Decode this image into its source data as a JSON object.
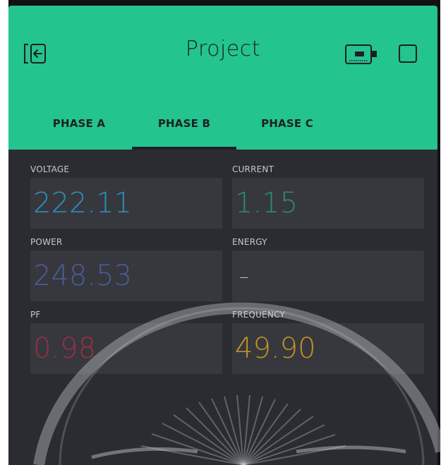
{
  "header": {
    "title": "Project",
    "back_icon": "exit-icon",
    "device_icon": "device-icon",
    "square_icon": "checkbox-icon",
    "background": "#23c48e"
  },
  "tabs": [
    {
      "label": "PHASE A",
      "selected": false
    },
    {
      "label": "PHASE B",
      "selected": true
    },
    {
      "label": "PHASE C",
      "selected": false
    }
  ],
  "widgets": {
    "voltage": {
      "label": "VOLTAGE",
      "value": "222.11",
      "color": "#2f8fb8"
    },
    "current": {
      "label": "CURRENT",
      "value": "1.15",
      "color": "#2e8a6e"
    },
    "power": {
      "label": "POWER",
      "value": "248.53",
      "color": "#4a5e95"
    },
    "energy": {
      "label": "ENERGY",
      "value": "–",
      "color": "#b9bbbf"
    },
    "pf": {
      "label": "PF",
      "value": "0.98",
      "color": "#9a3042"
    },
    "frequency": {
      "label": "FREQUENCY",
      "value": "49.90",
      "color": "#c39322"
    }
  }
}
